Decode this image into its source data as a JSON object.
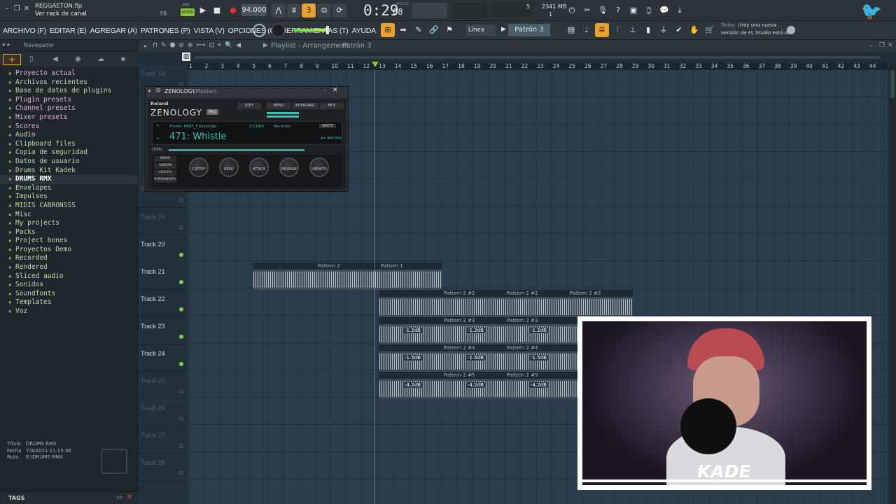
{
  "app": {
    "filename": "REGGAETON.flp",
    "hint": "Ver rack de canal",
    "hint_key": "F6"
  },
  "transport": {
    "mode": "SONG",
    "tempo": "94.000",
    "time": "0:29",
    "time_frac": "68",
    "time_label": "M:S:CS",
    "cpu": "5",
    "mem": "2341 MB",
    "poly": "1",
    "pat_label": "PAT",
    "song_label": "SONG"
  },
  "menu": {
    "items": [
      "ARCHIVO (F)",
      "EDITAR (E)",
      "AGREGAR (A)",
      "PATRONES (P)",
      "VISTA (V)",
      "OPCIONES (O)",
      "HERRAMIENTAS (T)",
      "AYUDA"
    ]
  },
  "toolbar": {
    "snap": "Línea",
    "pattern": "Patrón 3"
  },
  "news": {
    "date": "Today",
    "text1": "¡Hay una nueva",
    "text2": "versión de FL Studio está d..."
  },
  "navigator": {
    "title": "Navegador",
    "items": [
      {
        "label": "Proyecto actual",
        "c": "pink"
      },
      {
        "label": "Archivos recientes",
        "c": ""
      },
      {
        "label": "Base de datos de plugins",
        "c": ""
      },
      {
        "label": "Plugin presets",
        "c": "pink"
      },
      {
        "label": "Channel presets",
        "c": "pink"
      },
      {
        "label": "Mixer presets",
        "c": "pink"
      },
      {
        "label": "Scores",
        "c": "pink"
      },
      {
        "label": "Audio",
        "c": ""
      },
      {
        "label": "Clipboard files",
        "c": ""
      },
      {
        "label": "Copia de seguridad",
        "c": ""
      },
      {
        "label": "Datos de usuario",
        "c": ""
      },
      {
        "label": "Drums Kit Kadek",
        "c": ""
      },
      {
        "label": "DRUMS RMX",
        "c": "sel"
      },
      {
        "label": "Envelopes",
        "c": ""
      },
      {
        "label": "Impulses",
        "c": ""
      },
      {
        "label": "MIDIS CABRONSSS",
        "c": ""
      },
      {
        "label": "Misc",
        "c": ""
      },
      {
        "label": "My projects",
        "c": ""
      },
      {
        "label": "Packs",
        "c": ""
      },
      {
        "label": "Project bones",
        "c": ""
      },
      {
        "label": "Proyectos Demo",
        "c": ""
      },
      {
        "label": "Recorded",
        "c": ""
      },
      {
        "label": "Rendered",
        "c": ""
      },
      {
        "label": "Sliced audio",
        "c": ""
      },
      {
        "label": "Sonidos",
        "c": ""
      },
      {
        "label": "Soundfonts",
        "c": ""
      },
      {
        "label": "Templates",
        "c": ""
      },
      {
        "label": "Voz",
        "c": ""
      }
    ],
    "info": {
      "titulo_l": "Título",
      "titulo": "DRUMS RMX",
      "fecha_l": "Fecha",
      "fecha": "7/3/2021 11:15:36",
      "ruta_l": "Ruta",
      "ruta": "E:\\DRUMS RMX"
    },
    "tags": "TAGS"
  },
  "playlist": {
    "title": "Playlist - Arrangement",
    "pattern": "Patrón 3",
    "ruler": [
      "1",
      "2",
      "3",
      "4",
      "5",
      "6",
      "7",
      "8",
      "9",
      "10",
      "11",
      "12",
      "13",
      "14",
      "15",
      "16",
      "17",
      "18",
      "19",
      "20",
      "21",
      "22",
      "23",
      "24",
      "25",
      "26",
      "27",
      "28",
      "29",
      "30",
      "31",
      "32",
      "33",
      "34",
      "35",
      "36",
      "37",
      "38",
      "39",
      "40",
      "41",
      "42",
      "43",
      "44"
    ],
    "tracks": [
      {
        "label": "Track 13",
        "dim": true
      },
      {
        "label": "Track 18",
        "dim": true
      },
      {
        "label": "Track 19",
        "dim": true
      },
      {
        "label": "Track 20",
        "dim": false
      },
      {
        "label": "Track 21",
        "dim": false
      },
      {
        "label": "Track 22",
        "dim": false
      },
      {
        "label": "Track 23",
        "dim": false
      },
      {
        "label": "Track 24",
        "dim": false
      },
      {
        "label": "Track 25",
        "dim": true
      },
      {
        "label": "Track 26",
        "dim": true
      },
      {
        "label": "Track 27",
        "dim": true
      },
      {
        "label": "Track 28",
        "dim": true
      }
    ],
    "clip_labels": {
      "p2": "Pattern 2",
      "p1": "Pattern 1",
      "p2_2": "Pattern 2 #2",
      "p2_3": "Pattern 2 #3",
      "p2_4": "Pattern 2 #4",
      "p2_5": "Pattern 2 #5"
    },
    "db": {
      "a": "-1.2dB",
      "b": "-1.5dB",
      "c": "-4.2dB"
    }
  },
  "plugin": {
    "title": "ZENOLOGY",
    "title_sub": "(Master)",
    "brand": "Roland",
    "name": "ZENOLOGY",
    "badge": "Pro",
    "edit": "EDIT",
    "menu": "MENU",
    "keyboard": "KEYBOARD",
    "mfx": "MFX",
    "preset_label": "Preset: PRST_F Essential",
    "engine": "Z-CORE",
    "recorder": "Recorder",
    "write": "WRITE",
    "patch": "471:  Whistle",
    "tune": "A= 440.0Hz",
    "level": "LEVEL",
    "modes": [
      "MONO",
      "UNISON",
      "LEGATO",
      "PORTAMENTO"
    ],
    "knobs": [
      "CUTOFF",
      "RESO",
      "ATTACK",
      "RELEASE",
      "VIBRATO"
    ]
  },
  "webcam": {
    "name": "KADE"
  }
}
